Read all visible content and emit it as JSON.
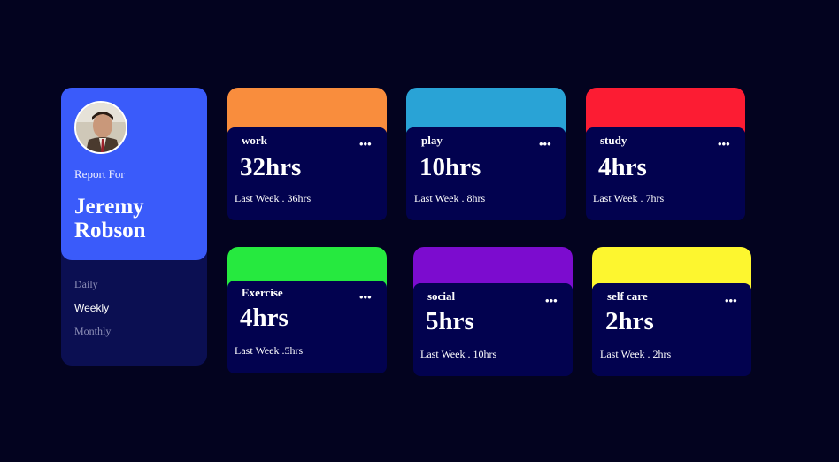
{
  "profile": {
    "report_for": "Report For",
    "name": "Jeremy Robson",
    "periods": [
      "Daily",
      "Weekly",
      "Monthly"
    ],
    "selected_period": "Weekly"
  },
  "cards": [
    {
      "title": "work",
      "hours": "32hrs",
      "last": "Last Week . 36hrs",
      "color": "#f98d3d"
    },
    {
      "title": "play",
      "hours": "10hrs",
      "last": "Last Week . 8hrs",
      "color": "#29a3d6"
    },
    {
      "title": "study",
      "hours": "4hrs",
      "last": "Last Week . 7hrs",
      "color": "#fc1c33"
    },
    {
      "title": "Exercise",
      "hours": "4hrs",
      "last": "Last Week .5hrs",
      "color": "#26e93f"
    },
    {
      "title": "social",
      "hours": "5hrs",
      "last": "Last Week . 10hrs",
      "color": "#7c0ccf"
    },
    {
      "title": "self care",
      "hours": "2hrs",
      "last": "Last Week . 2hrs",
      "color": "#fdf62f"
    }
  ],
  "menu_icon": "ellipsis-icon",
  "colors": {
    "background": "#03031f",
    "profile_card": "#3a5bfa",
    "card_body": "#02024f"
  }
}
